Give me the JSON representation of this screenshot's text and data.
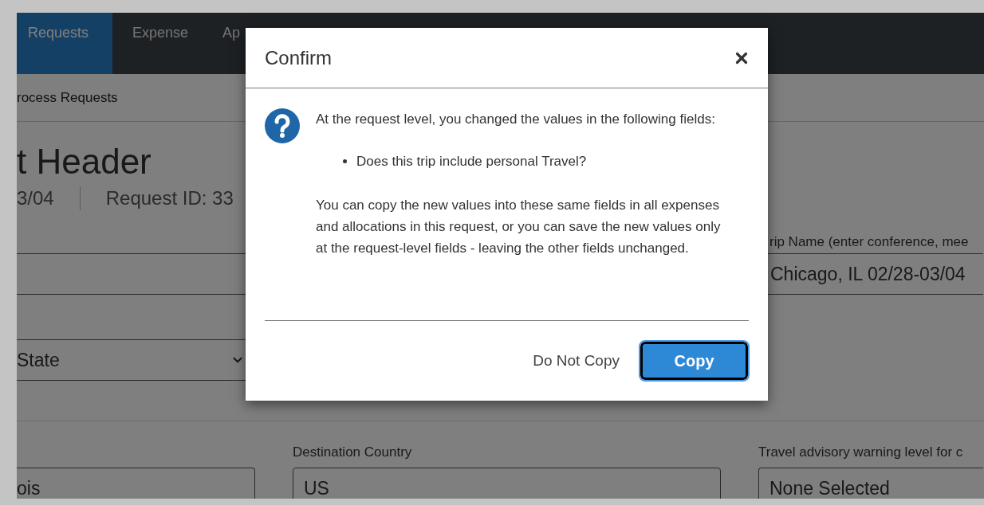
{
  "nav": {
    "tabs": [
      {
        "label": "Requests",
        "selected": true
      },
      {
        "label": "Expense",
        "selected": false
      },
      {
        "label": "Ap",
        "selected": false
      }
    ]
  },
  "breadcrumb": "rocess Requests",
  "header": {
    "title": "t Header",
    "dates": "3/04",
    "request_id": "Request ID: 33"
  },
  "form": {
    "trip_name": {
      "label": "rip Name (enter conference, mee",
      "value": "Chicago, IL 02/28-03/04"
    },
    "state_select": {
      "value": "State"
    },
    "column_1": {
      "value": "ois"
    },
    "destination_country": {
      "label": "Destination Country",
      "value": "US"
    },
    "travel_advisory": {
      "label": "Travel advisory warning level for c",
      "value": "None Selected"
    }
  },
  "dialog": {
    "title": "Confirm",
    "message": "At the request level, you changed the values in the following fields:",
    "items": [
      "Does this trip include personal Travel?"
    ],
    "note": "You can copy the new values into these same fields in all expenses and allocations in this request, or you can save the new values only at the request-level fields - leaving the other fields unchanged.",
    "buttons": [
      {
        "label": "Do Not Copy",
        "kind": "link",
        "focused": false
      },
      {
        "label": "Copy",
        "kind": "primary",
        "focused": true
      }
    ]
  }
}
